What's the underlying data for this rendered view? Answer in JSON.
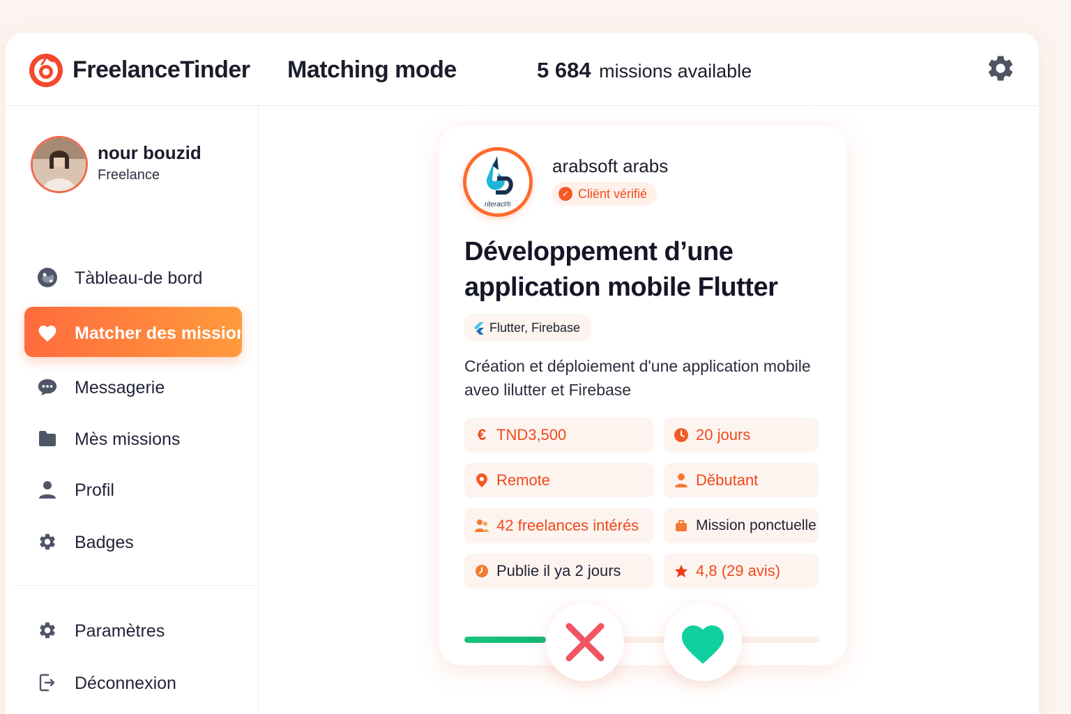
{
  "header": {
    "brand": "FreelanceTinder",
    "mode_title": "Matching mode",
    "missions_count": "5 684",
    "missions_label": "missions available",
    "settings_icon": "gear-icon"
  },
  "user": {
    "name": "nour bouzid",
    "role": "Freelance"
  },
  "sidebar": {
    "items": [
      {
        "label": "Tàbleau-de bord",
        "icon": "dashboard-icon"
      },
      {
        "label": "Matcher des mission",
        "icon": "heart-icon",
        "active": true
      },
      {
        "label": "Messagerie",
        "icon": "chat-icon"
      },
      {
        "label": "Mès missions",
        "icon": "folder-icon"
      },
      {
        "label": "Profil",
        "icon": "user-icon"
      },
      {
        "label": "Badges",
        "icon": "gear-icon"
      }
    ],
    "bottom": [
      {
        "label": "Paramètres",
        "icon": "gear-icon"
      },
      {
        "label": "Déconnexion",
        "icon": "logout-icon"
      }
    ]
  },
  "card": {
    "client_name": "arabsoft arabs",
    "client_logo_text": "riteract®",
    "verified_label": "Cliënt vérifié",
    "title": "Développement d’une application mobile Flutter",
    "tech": "Flutter, Firebase",
    "description": "Création et déploiement d'une application mobile aveo lilutter et Firebase",
    "stats": {
      "budget": "TND3,500",
      "duration": "20 jours",
      "location": "Remote",
      "level": "Dĕbutant",
      "interested": "42 freelances intérés",
      "type": "Mission ponctuelle",
      "published": "Publie il ya 2 jours",
      "rating": "4,8 (29 avis)"
    },
    "progress": 0.23,
    "colors": {
      "accent": "#ff6b3d",
      "reject": "#f25462",
      "like": "#10cfa0"
    }
  }
}
